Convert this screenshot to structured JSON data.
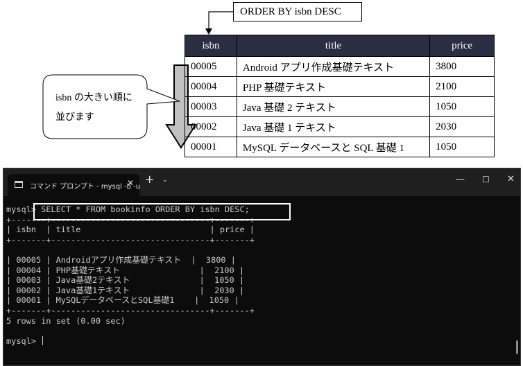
{
  "diagram": {
    "callout": "ORDER BY isbn DESC",
    "bubble_lines": [
      "isbn の大きい順に",
      "並びます"
    ],
    "headers": [
      "isbn",
      "title",
      "price"
    ],
    "rows": [
      {
        "isbn": "00005",
        "title": "Android アプリ作成基礎テキスト",
        "price": "3800"
      },
      {
        "isbn": "00004",
        "title": "PHP 基礎テキスト",
        "price": "2100"
      },
      {
        "isbn": "00003",
        "title": "Java 基礎 2 テキスト",
        "price": "1050"
      },
      {
        "isbn": "00002",
        "title": "Java 基礎 1 テキスト",
        "price": "2030"
      },
      {
        "isbn": "00001",
        "title": "MySQL データベースと SQL 基礎 1",
        "price": "1050"
      }
    ],
    "colors": {
      "header_bg": "#2b2d42",
      "arrow_fill": "#c0c0c0"
    }
  },
  "terminal": {
    "tab_title": "コマンド プロンプト - mysql  -b -u",
    "tab_close": "✕",
    "new_tab": "+",
    "dropdown": "⌄",
    "minimize": "—",
    "maximize": "☐",
    "close": "✕",
    "prompt_line": "mysql> SELECT * FROM bookinfo ORDER BY isbn DESC;",
    "border_line": "+-------+--------------------------------+-------+",
    "header_line": "| isbn  | title                          | price |",
    "data_lines": [
      "| 00005 | Androidアプリ作成基礎テキスト  |  3800 |",
      "| 00004 | PHP基礎テキスト                |  2100 |",
      "| 00003 | Java基礎2テキスト              |  1050 |",
      "| 00002 | Java基礎1テキスト              |  2030 |",
      "| 00001 | MySQLデータベースとSQL基礎1    |  1050 |"
    ],
    "result_line": "5 rows in set (0.00 sec)",
    "final_prompt": "mysql> ",
    "colors": {
      "bg": "#0c0c0c",
      "titlebar": "#1f1f1f",
      "text": "#cccccc"
    }
  }
}
